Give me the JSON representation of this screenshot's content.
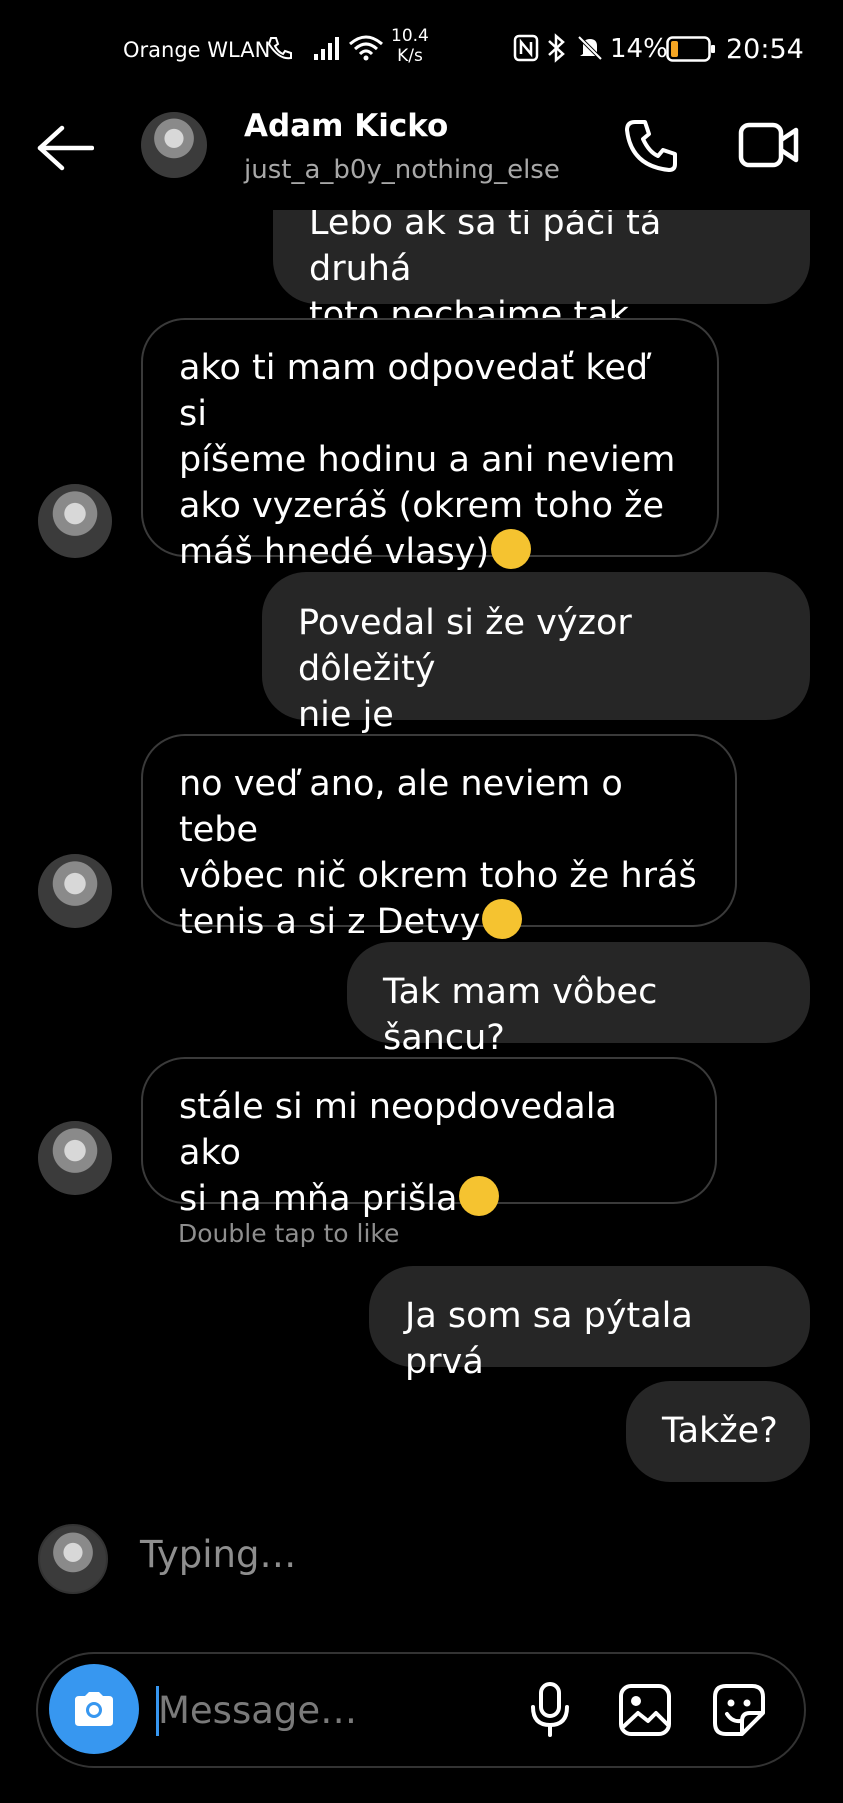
{
  "status_bar": {
    "carrier": "Orange WLAN",
    "net_speed_value": "10.4",
    "net_speed_unit": "K/s",
    "battery": "14%",
    "time": "20:54"
  },
  "header": {
    "name": "Adam Kicko",
    "username": "just_a_b0y_nothing_else"
  },
  "messages": [
    {
      "direction": "outgoing",
      "lines": [
        "Lebo ak sa ti páči tá druhá",
        "toto nechajme tak"
      ]
    },
    {
      "direction": "incoming",
      "lines": [
        "ako ti mam odpovedať keď si",
        "píšeme hodinu a ani neviem",
        "ako vyzeráš (okrem toho že",
        "máš hnedé vlasy)"
      ],
      "emoji": "sweat-smile"
    },
    {
      "direction": "outgoing",
      "lines": [
        "Povedal si že výzor dôležitý",
        "nie je"
      ]
    },
    {
      "direction": "incoming",
      "lines": [
        "no veď ano, ale neviem o tebe",
        "vôbec nič okrem toho že hráš",
        "tenis a si z Detvy"
      ],
      "emoji": "sweat-smile"
    },
    {
      "direction": "outgoing",
      "lines": [
        "Tak mam vôbec šancu?"
      ]
    },
    {
      "direction": "incoming",
      "lines": [
        "stále si mi neopdovedala ako",
        "si na mňa prišla"
      ],
      "emoji": "sweat-smile"
    },
    {
      "direction": "outgoing",
      "lines": [
        "Ja som sa pýtala prvá"
      ]
    },
    {
      "direction": "outgoing",
      "lines": [
        "Takže?"
      ]
    }
  ],
  "double_tap_hint": "Double tap to like",
  "typing_indicator": "Typing…",
  "composer": {
    "placeholder": "Message…"
  },
  "colors": {
    "background": "#000000",
    "outgoing_bubble": "#262626",
    "accent": "#3797f0"
  }
}
